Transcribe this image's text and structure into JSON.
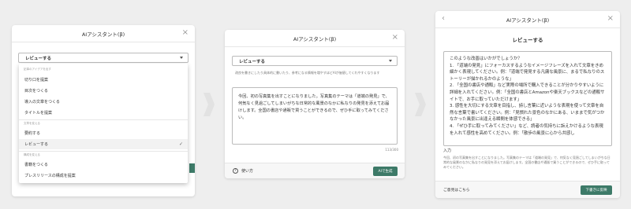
{
  "panel1": {
    "title": "AIアシスタント(β)",
    "select_value": "レビューする",
    "groups": [
      {
        "label": "記事のアイデアを出す",
        "items": [
          "切り口を提案",
          "目次をつくる",
          "導入の文章をつくる",
          "タイトルを提案"
        ]
      },
      {
        "label": "文章を変える",
        "items": [
          "要約する",
          "レビューする"
        ]
      },
      {
        "label": "構成を変える",
        "items": [
          "書籍をつくる",
          "プレスリリースの構成を提案"
        ]
      }
    ],
    "selected_item": "レビューする"
  },
  "panel2": {
    "title": "AIアシスタント(β)",
    "select_value": "レビューする",
    "hint": "改良を書きにしたり具体的に書いたり、参考になる情報を増やすほどAIが価値してくれやすくなります",
    "input_text": "今回、初の写真集を出すことになりました。写真集のテーマは「道端の発見」で、何気なく見過ごしてしまいがちな日常的な風景のなかに私なりの発見を添えてお届けします。全国の書店や通販で買うことができるので、ぜひ手に取ってみてください。",
    "counter": "113/300",
    "help_label": "使い方",
    "generate_label": "AIで生成"
  },
  "panel3": {
    "title": "AIアシスタント(β)",
    "subtitle": "レビューする",
    "output_lines": [
      "このような改善はいかがでしょうか？",
      "1. 「道端の発見」にフォーカスするようなイメージフレーズを入れて文章をきめ細かく表現してください。例：「道端で発見する凡庸な風景に、まるで私なりのストーリーが描かれるかのような」",
      "2. 「全国の書店や通販」など実際の場所で購入できることが分かりやすいように詳細を入れてください。例：「全国の書店とAmazonや楽天ブックスなどの通販サイトで、お手に取っていただけます」",
      "3. 感性を大切にする文章を目指し、詩し言葉に近いような表現を使って文章を自然な言葉で書いてください。例：「見慣れた景色のなかにある、いままで気がつかなかった風景に出逢える瞬間を体感できる」",
      "4. 「ぜひ手に取ってみてください」など、読者の気持ちに訴えかけるような表現を入れて感性を高めてください。例：「散歩の風景に心から共感し"
    ],
    "input_label": "入力",
    "input_text": "今回、初の写真集を出すことになりました。写真集のテーマは「道端の発見」で、何気なく見過ごしてしまいがちな日常的な風景のなかに私なりの発見を添えてお届けします。全国の書店や通販で買うことができるので、ぜひ手に取ってみてください。",
    "feedback_label": "ご意見はこちら",
    "insert_label": "下書きに反映"
  }
}
